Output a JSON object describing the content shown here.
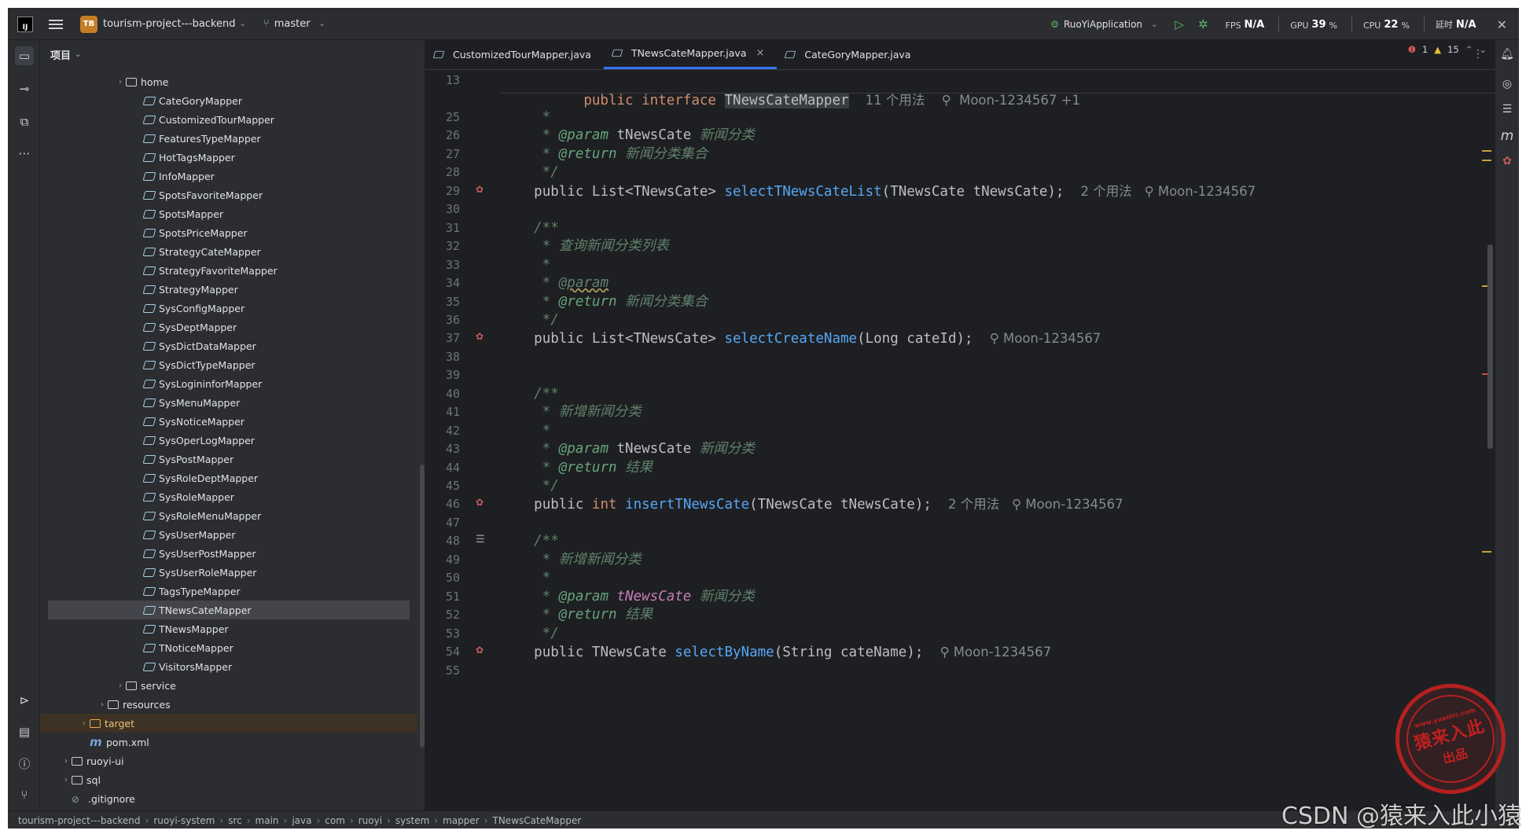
{
  "topbar": {
    "logo": "IJ",
    "project_badge": "TB",
    "project_name": "tourism-project---backend",
    "branch": "master",
    "run_config": "RuoYiApplication",
    "fps_label": "FPS",
    "fps_value": "N/A",
    "gpu_label": "GPU",
    "gpu_value": "39",
    "cpu_label": "CPU",
    "cpu_value": "22",
    "pct": "%",
    "latency_label": "延时",
    "latency_value": "N/A"
  },
  "project_panel": {
    "title": "项目",
    "tree": [
      {
        "label": "home",
        "type": "folder",
        "indent": 3,
        "chevron": "›"
      },
      {
        "label": "CateGoryMapper",
        "type": "iface",
        "indent": 4
      },
      {
        "label": "CustomizedTourMapper",
        "type": "iface",
        "indent": 4
      },
      {
        "label": "FeaturesTypeMapper",
        "type": "iface",
        "indent": 4
      },
      {
        "label": "HotTagsMapper",
        "type": "iface",
        "indent": 4
      },
      {
        "label": "InfoMapper",
        "type": "iface",
        "indent": 4
      },
      {
        "label": "SpotsFavoriteMapper",
        "type": "iface",
        "indent": 4
      },
      {
        "label": "SpotsMapper",
        "type": "iface",
        "indent": 4
      },
      {
        "label": "SpotsPriceMapper",
        "type": "iface",
        "indent": 4
      },
      {
        "label": "StrategyCateMapper",
        "type": "iface",
        "indent": 4
      },
      {
        "label": "StrategyFavoriteMapper",
        "type": "iface",
        "indent": 4
      },
      {
        "label": "StrategyMapper",
        "type": "iface",
        "indent": 4
      },
      {
        "label": "SysConfigMapper",
        "type": "iface",
        "indent": 4
      },
      {
        "label": "SysDeptMapper",
        "type": "iface",
        "indent": 4
      },
      {
        "label": "SysDictDataMapper",
        "type": "iface",
        "indent": 4
      },
      {
        "label": "SysDictTypeMapper",
        "type": "iface",
        "indent": 4
      },
      {
        "label": "SysLogininforMapper",
        "type": "iface",
        "indent": 4
      },
      {
        "label": "SysMenuMapper",
        "type": "iface",
        "indent": 4
      },
      {
        "label": "SysNoticeMapper",
        "type": "iface",
        "indent": 4
      },
      {
        "label": "SysOperLogMapper",
        "type": "iface",
        "indent": 4
      },
      {
        "label": "SysPostMapper",
        "type": "iface",
        "indent": 4
      },
      {
        "label": "SysRoleDeptMapper",
        "type": "iface",
        "indent": 4
      },
      {
        "label": "SysRoleMapper",
        "type": "iface",
        "indent": 4
      },
      {
        "label": "SysRoleMenuMapper",
        "type": "iface",
        "indent": 4
      },
      {
        "label": "SysUserMapper",
        "type": "iface",
        "indent": 4
      },
      {
        "label": "SysUserPostMapper",
        "type": "iface",
        "indent": 4
      },
      {
        "label": "SysUserRoleMapper",
        "type": "iface",
        "indent": 4
      },
      {
        "label": "TagsTypeMapper",
        "type": "iface",
        "indent": 4
      },
      {
        "label": "TNewsCateMapper",
        "type": "iface",
        "indent": 4,
        "selected": true
      },
      {
        "label": "TNewsMapper",
        "type": "iface",
        "indent": 4
      },
      {
        "label": "TNoticeMapper",
        "type": "iface",
        "indent": 4
      },
      {
        "label": "VisitorsMapper",
        "type": "iface",
        "indent": 4
      },
      {
        "label": "service",
        "type": "folder",
        "indent": 3,
        "chevron": "›"
      },
      {
        "label": "resources",
        "type": "folder",
        "indent": 2,
        "chevron": "›"
      },
      {
        "label": "target",
        "type": "folder",
        "indent": 1,
        "chevron": "›",
        "excluded": true
      },
      {
        "label": "pom.xml",
        "type": "xml",
        "indent": 1
      },
      {
        "label": "ruoyi-ui",
        "type": "folder",
        "indent": 0,
        "chevron": "›"
      },
      {
        "label": "sql",
        "type": "folder",
        "indent": 0,
        "chevron": "›"
      },
      {
        "label": ".gitignore",
        "type": "file",
        "indent": 0
      }
    ]
  },
  "tabs": [
    {
      "label": "CustomizedTourMapper.java",
      "active": false
    },
    {
      "label": "TNewsCateMapper.java",
      "active": true,
      "close": "×"
    },
    {
      "label": "CateGoryMapper.java",
      "active": false
    }
  ],
  "editor": {
    "sticky": {
      "line": "13",
      "kw1": "public",
      "kw2": "interface",
      "name": "TNewsCateMapper",
      "usages": "11 个用法",
      "author": "Moon-1234567 +1"
    },
    "inspections": {
      "errors": "1",
      "warnings": "15"
    },
    "lines": [
      {
        "n": "25",
        "html": "<span class='doc'>     *</span>"
      },
      {
        "n": "26",
        "html": "<span class='doc'>     * </span><span class='tag'>@param</span><span class='pm'> tNewsCate </span><span class='doc'>新闻分类</span>"
      },
      {
        "n": "27",
        "html": "<span class='doc'>     * </span><span class='tag'>@return</span><span class='doc'> 新闻分类集合</span>"
      },
      {
        "n": "28",
        "html": "<span class='doc'>     */</span>"
      },
      {
        "n": "29",
        "bp": true,
        "html": "    <span class='ty'>public List&lt;TNewsCate&gt; </span><span class='fn'>selectTNewsCateList</span><span class='ty'>(TNewsCate tNewsCate);</span>  <span class='hint'>2 个用法   ⚲ Moon-1234567</span>"
      },
      {
        "n": "30",
        "html": ""
      },
      {
        "n": "31",
        "html": "<span class='doc'>    /**</span>"
      },
      {
        "n": "32",
        "html": "<span class='doc'>     * 查询新闻分类列表</span>"
      },
      {
        "n": "33",
        "html": "<span class='doc'>     *</span>"
      },
      {
        "n": "34",
        "html": "<span class='doc'>     * </span><span class='dw'>@param</span>"
      },
      {
        "n": "35",
        "html": "<span class='doc'>     * </span><span class='tag'>@return</span><span class='doc'> 新闻分类集合</span>"
      },
      {
        "n": "36",
        "html": "<span class='doc'>     */</span>"
      },
      {
        "n": "37",
        "bp": true,
        "html": "    <span class='ty'>public List&lt;TNewsCate&gt; </span><span class='fn'>selectCreateName</span><span class='ty'>(Long cateId);</span>  <span class='hint'>⚲ Moon-1234567</span>"
      },
      {
        "n": "38",
        "html": ""
      },
      {
        "n": "39",
        "html": ""
      },
      {
        "n": "40",
        "html": "<span class='doc'>    /**</span>"
      },
      {
        "n": "41",
        "html": "<span class='doc'>     * 新增新闻分类</span>"
      },
      {
        "n": "42",
        "html": "<span class='doc'>     *</span>"
      },
      {
        "n": "43",
        "html": "<span class='doc'>     * </span><span class='tag'>@param</span><span class='pm'> tNewsCate </span><span class='doc'>新闻分类</span>"
      },
      {
        "n": "44",
        "html": "<span class='doc'>     * </span><span class='tag'>@return</span><span class='doc'> 结果</span>"
      },
      {
        "n": "45",
        "html": "<span class='doc'>     */</span>"
      },
      {
        "n": "46",
        "bp": true,
        "html": "    <span class='ty'>public </span><span class='kw'>int</span><span class='ty'> </span><span class='fn'>insertTNewsCate</span><span class='ty'>(TNewsCate tNewsCate);</span>  <span class='hint'>2 个用法   ⚲ Moon-1234567</span>"
      },
      {
        "n": "47",
        "html": ""
      },
      {
        "n": "48",
        "lines_icon": true,
        "html": "<span class='doc'>    /**</span>"
      },
      {
        "n": "49",
        "html": "<span class='doc'>     * 新增新闻分类</span>"
      },
      {
        "n": "50",
        "html": "<span class='doc'>     *</span>"
      },
      {
        "n": "51",
        "html": "<span class='doc'>     * </span><span class='tag'>@param</span><span class='pmr'> tNewsCate </span><span class='doc'>新闻分类</span>"
      },
      {
        "n": "52",
        "html": "<span class='doc'>     * </span><span class='tag'>@return</span><span class='doc'> 结果</span>"
      },
      {
        "n": "53",
        "html": "<span class='doc'>     */</span>"
      },
      {
        "n": "54",
        "bp": true,
        "html": "    <span class='ty'>public TNewsCate </span><span class='fn'>selectByName</span><span class='ty'>(String cateName);</span>  <span class='hint'>⚲ Moon-1234567</span>"
      },
      {
        "n": "55",
        "html": ""
      }
    ]
  },
  "statusbar": {
    "crumbs": [
      "tourism-project---backend",
      "ruoyi-system",
      "src",
      "main",
      "java",
      "com",
      "ruoyi",
      "system",
      "mapper",
      "TNewsCateMapper"
    ]
  },
  "watermark": "CSDN @猿来入此小猿",
  "seal": {
    "line1": "猿来入此",
    "line2": "出品",
    "url": "www.yuanlrc.com"
  }
}
